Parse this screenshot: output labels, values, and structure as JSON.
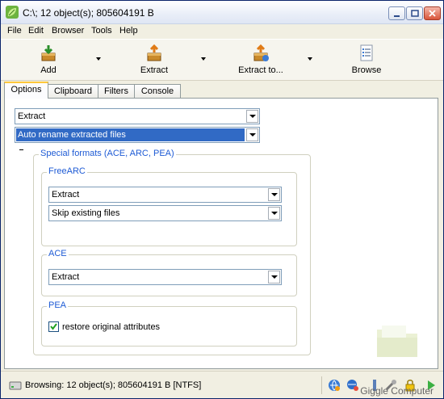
{
  "window": {
    "title": "C:\\; 12 object(s); 805604191 B"
  },
  "menu": [
    "File",
    "Edit",
    "Browser",
    "Tools",
    "Help"
  ],
  "toolbar": {
    "add_label": "Add",
    "extract_label": "Extract",
    "extract_to_label": "Extract to...",
    "browse_label": "Browse"
  },
  "tabs": [
    "Options",
    "Clipboard",
    "Filters",
    "Console"
  ],
  "options": {
    "action": "Extract",
    "overwrite": "Auto rename extracted files",
    "special_formats": {
      "title": "Special formats (ACE, ARC, PEA)",
      "freearc": {
        "title": "FreeARC",
        "action": "Extract",
        "overwrite": "Skip existing files"
      },
      "ace": {
        "title": "ACE",
        "action": "Extract"
      },
      "pea": {
        "title": "PEA",
        "restore_label": "restore original attributes",
        "restore_checked": true
      }
    }
  },
  "status": {
    "text": "Browsing: 12 object(s); 805604191 B [NTFS]"
  },
  "watermark": "Giggle Computer",
  "colors": {
    "group_title": "#1e5bd5",
    "selection": "#316ac5",
    "active_tab": "#ffc83c"
  }
}
